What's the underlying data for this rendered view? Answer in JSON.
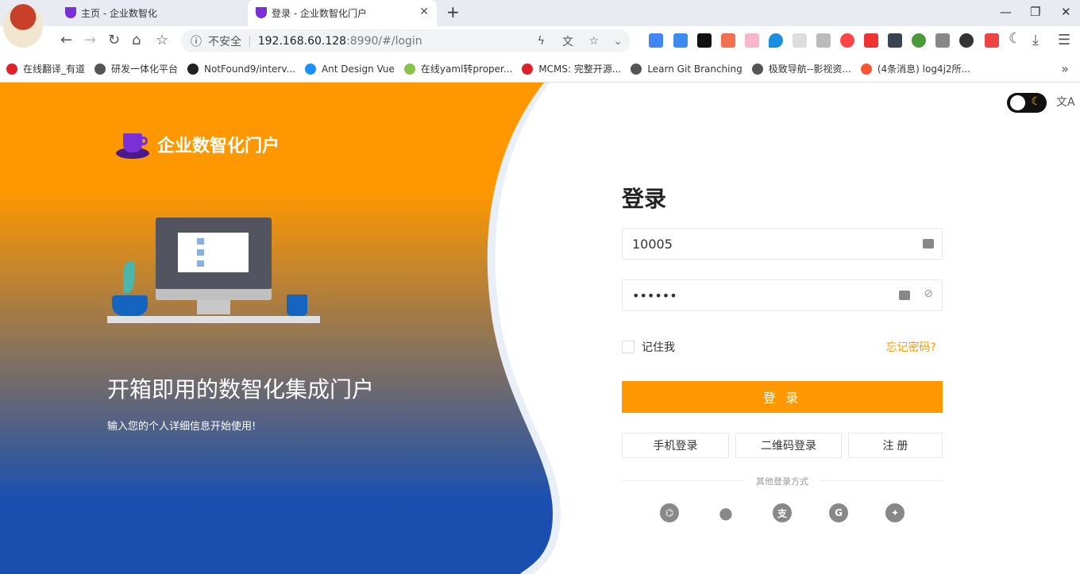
{
  "browser": {
    "tabs": [
      {
        "title": "主页 - 企业数智化",
        "active": false
      },
      {
        "title": "登录 - 企业数智化门户",
        "active": true
      }
    ],
    "security_label": "不安全",
    "url_host": "192.168.60.128",
    "url_path": ":8990/#/login",
    "bookmarks": [
      {
        "label": "在线翻译_有道",
        "color": "#e0202a"
      },
      {
        "label": "研发一体化平台",
        "color": "#555"
      },
      {
        "label": "NotFound9/interv...",
        "color": "#222"
      },
      {
        "label": "Ant Design Vue",
        "color": "#1890ff"
      },
      {
        "label": "在线yaml转proper...",
        "color": "#8bc34a"
      },
      {
        "label": "MCMS: 完整开源...",
        "color": "#e0202a"
      },
      {
        "label": "Learn Git Branching",
        "color": "#555"
      },
      {
        "label": "极致导航--影视资...",
        "color": "#555"
      },
      {
        "label": "(4条消息) log4j2所...",
        "color": "#fc5531"
      }
    ],
    "more_bookmarks": "»"
  },
  "brand": {
    "name": "企业数智化门户"
  },
  "hero": {
    "slogan": "开箱即用的数智化集成门户",
    "subtitle": "输入您的个人详细信息开始使用!",
    "gradient_top": "#ff9800",
    "gradient_bottom": "#1a4fb0"
  },
  "login": {
    "title": "登录",
    "username": "10005",
    "password_masked": "••••••",
    "remember_label": "记住我",
    "remember_checked": false,
    "forgot_label": "忘记密码?",
    "submit_label": "登 录",
    "alt_buttons": [
      "手机登录",
      "二维码登录",
      "注 册"
    ],
    "other_label": "其他登录方式",
    "social": [
      "github-icon",
      "wechat-icon",
      "alipay-icon",
      "google-icon",
      "twitter-icon"
    ],
    "accent": "#ff9800"
  },
  "topright": {
    "theme": "dark-mode-toggle",
    "lang_icon": "translate-icon"
  }
}
